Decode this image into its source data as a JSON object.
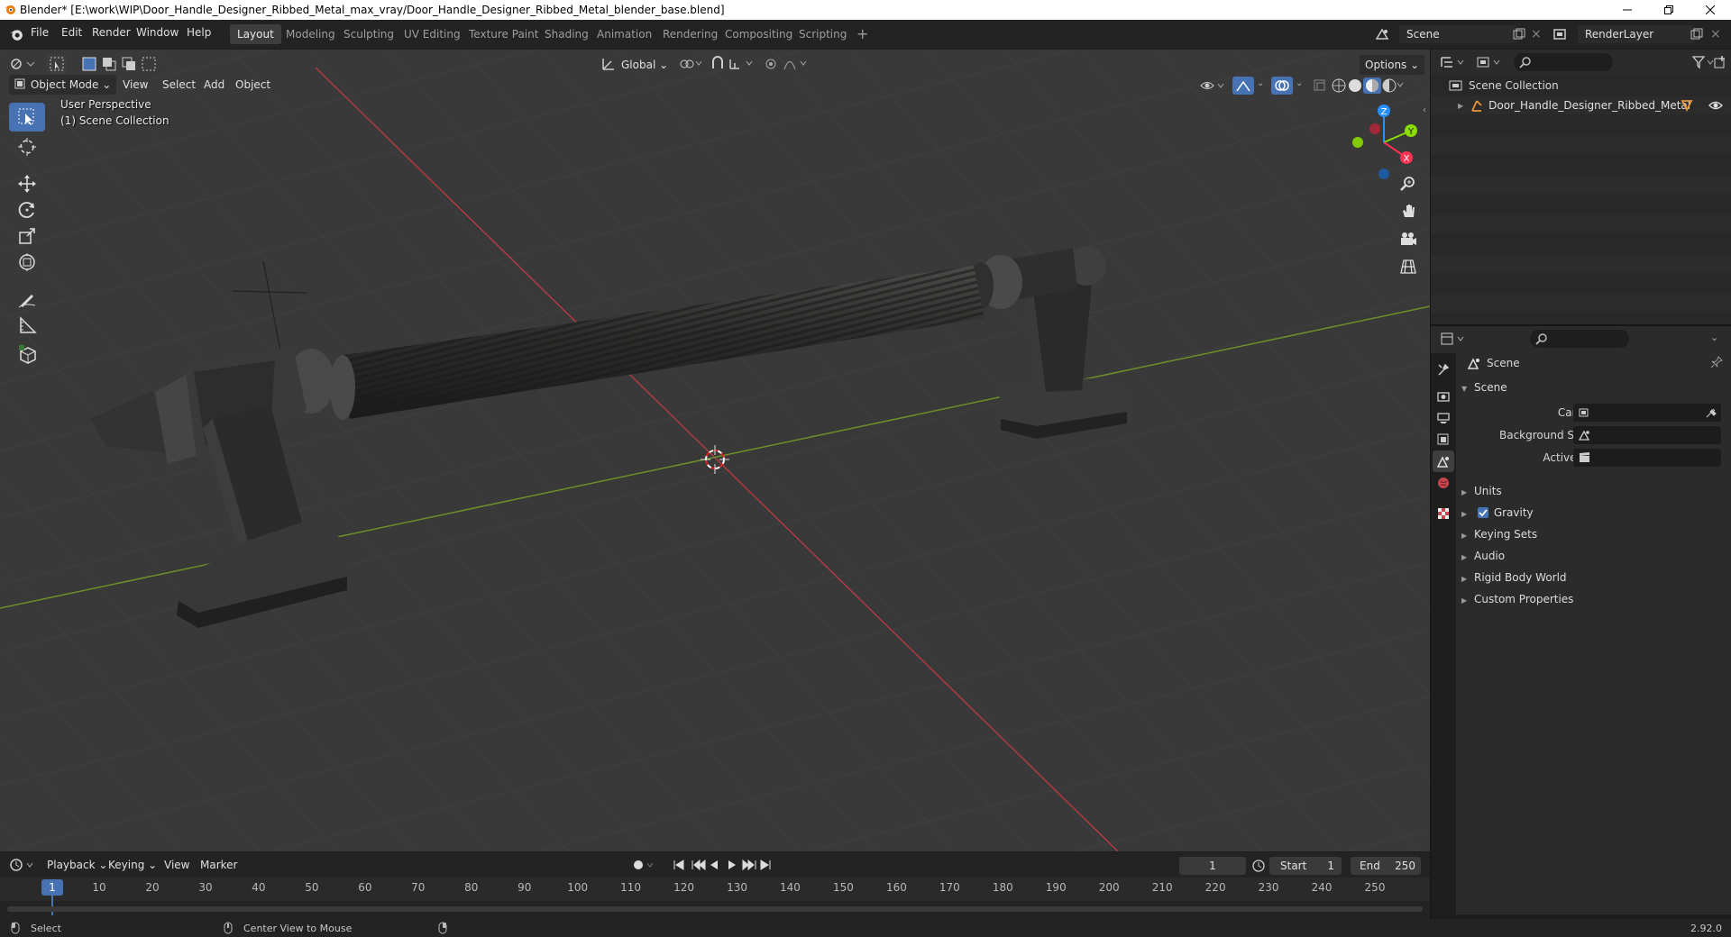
{
  "window": {
    "title": "Blender* [E:\\work\\WIP\\Door_Handle_Designer_Ribbed_Metal_max_vray/Door_Handle_Designer_Ribbed_Metal_blender_base.blend]"
  },
  "menu": [
    "File",
    "Edit",
    "Render",
    "Window",
    "Help"
  ],
  "workspaces": [
    "Layout",
    "Modeling",
    "Sculpting",
    "UV Editing",
    "Texture Paint",
    "Shading",
    "Animation",
    "Rendering",
    "Compositing",
    "Scripting"
  ],
  "active_workspace": "Layout",
  "scene_field": "Scene",
  "renderlayer_field": "RenderLayer",
  "viewport": {
    "mode": "Object Mode",
    "menus": [
      "View",
      "Select",
      "Add",
      "Object"
    ],
    "transform_orientation": "Global",
    "options_label": "Options",
    "overlay_line1": "User Perspective",
    "overlay_line2": "(1) Scene Collection",
    "gizmo": {
      "x": "X",
      "y": "Y",
      "z": "Z"
    }
  },
  "outliner": {
    "root": "Scene Collection",
    "items": [
      {
        "name": "Door_Handle_Designer_Ribbed_Metal"
      }
    ]
  },
  "properties": {
    "header": "Scene",
    "section": "Scene",
    "fields": [
      {
        "label": "Camera"
      },
      {
        "label": "Background Scene"
      },
      {
        "label": "Active Clip"
      }
    ],
    "panels": [
      "Units",
      "Gravity",
      "Keying Sets",
      "Audio",
      "Rigid Body World",
      "Custom Properties"
    ],
    "gravity_checked": true
  },
  "timeline": {
    "menus": [
      "Playback",
      "Keying",
      "View",
      "Marker"
    ],
    "current_frame": "1",
    "start_label": "Start",
    "start": "1",
    "end_label": "End",
    "end": "250",
    "ticks": [
      "1",
      "10",
      "20",
      "30",
      "40",
      "50",
      "60",
      "70",
      "80",
      "90",
      "100",
      "110",
      "120",
      "130",
      "140",
      "150",
      "160",
      "170",
      "180",
      "190",
      "200",
      "210",
      "220",
      "230",
      "240",
      "250"
    ]
  },
  "status": {
    "select": "Select",
    "center": "Center View to Mouse",
    "version": "2.92.0"
  },
  "colors": {
    "accent": "#4772b3",
    "x_axis": "#ff3352",
    "y_axis": "#8bdc00",
    "z_axis": "#2890ff",
    "viewport_bg": "#393939"
  }
}
